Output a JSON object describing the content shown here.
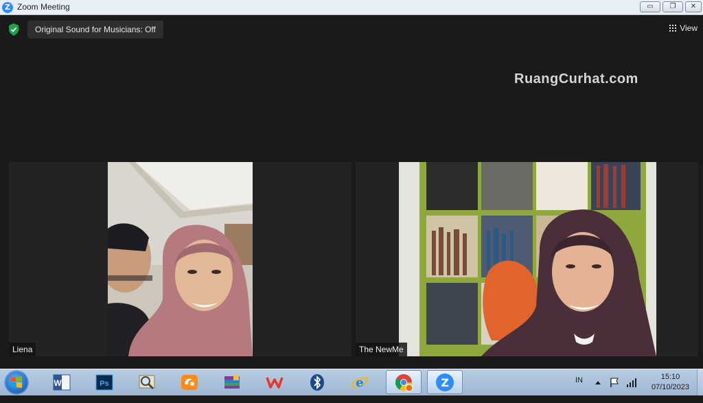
{
  "window": {
    "title": "Zoom Meeting",
    "logo_letter": "Z",
    "minimize": "▭",
    "restore": "❐",
    "close": "✕"
  },
  "meeting": {
    "sound_toggle": "Original Sound for Musicians: Off",
    "view_label": "View",
    "watermark": "RuangCurhat.com",
    "participants": [
      {
        "name": "Liena"
      },
      {
        "name": "The NewMe"
      }
    ]
  },
  "taskbar": {
    "apps": [
      {
        "name": "word",
        "letter": "W"
      },
      {
        "name": "photoshop",
        "letter": "Ps"
      },
      {
        "name": "search",
        "letter": ""
      },
      {
        "name": "uc-browser",
        "letter": ""
      },
      {
        "name": "winrar",
        "letter": ""
      },
      {
        "name": "wps",
        "letter": "W"
      },
      {
        "name": "bluetooth",
        "letter": ""
      },
      {
        "name": "internet-explorer",
        "letter": "e"
      },
      {
        "name": "chrome",
        "letter": ""
      },
      {
        "name": "zoom",
        "letter": "Z"
      }
    ],
    "language": "IN",
    "time": "15:10",
    "date": "07/10/2023"
  },
  "colors": {
    "zoom_blue": "#2d8cff",
    "shield_green": "#1aa34a",
    "background": "#1a1a1a"
  }
}
